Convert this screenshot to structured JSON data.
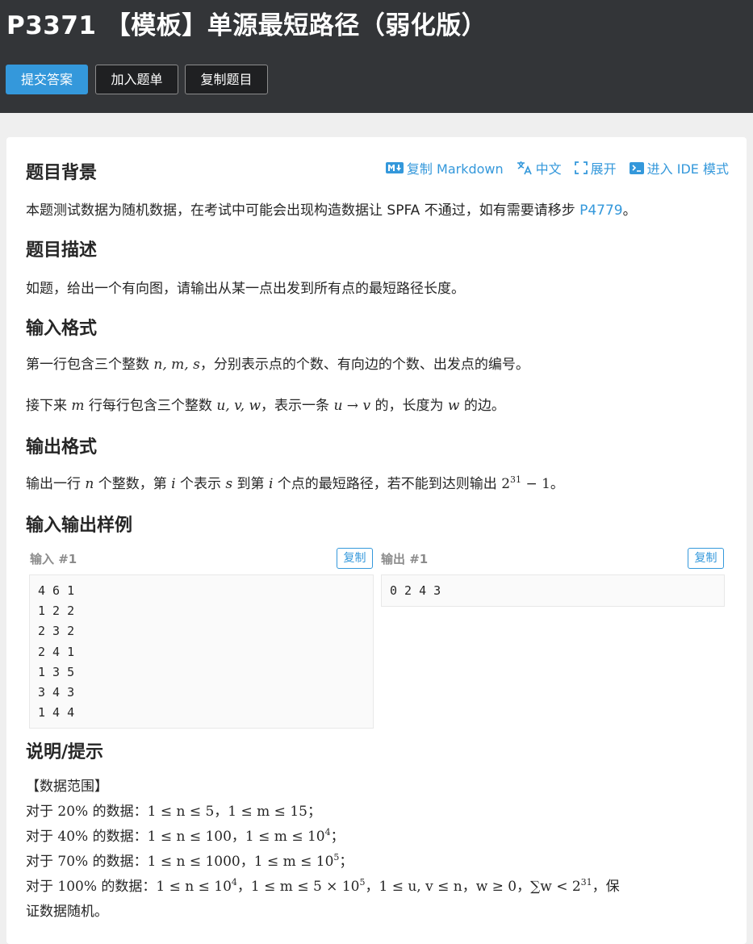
{
  "header": {
    "title": "P3371 【模板】单源最短路径（弱化版）",
    "buttons": {
      "submit": "提交答案",
      "add_to_list": "加入题单",
      "copy_problem": "复制题目"
    }
  },
  "toolbar": {
    "copy_markdown": "复制 Markdown",
    "language": "中文",
    "expand": "展开",
    "ide_mode": "进入 IDE 模式"
  },
  "sections": {
    "background": {
      "heading": "题目背景",
      "text_before": "本题测试数据为随机数据，在考试中可能会出现构造数据让 SPFA 不通过，如有需要请移步 ",
      "link": "P4779",
      "text_after": "。"
    },
    "description": {
      "heading": "题目描述",
      "text": "如题，给出一个有向图，请输出从某一点出发到所有点的最短路径长度。"
    },
    "input_format": {
      "heading": "输入格式",
      "line1_a": "第一行包含三个整数 ",
      "line1_math": "n, m, s",
      "line1_b": "，分别表示点的个数、有向边的个数、出发点的编号。",
      "line2_a": "接下来 ",
      "line2_m": "m",
      "line2_b": " 行每行包含三个整数 ",
      "line2_uvw": "u, v, w",
      "line2_c": "，表示一条 ",
      "line2_edge": "u → v",
      "line2_d": " 的，长度为 ",
      "line2_w": "w",
      "line2_e": " 的边。"
    },
    "output_format": {
      "heading": "输出格式",
      "a": "输出一行 ",
      "n": "n",
      "b": " 个整数，第 ",
      "i": "i",
      "c": " 个表示 ",
      "s": "s",
      "d": " 到第 ",
      "i2": "i",
      "e": " 个点的最短路径，若不能到达则输出 ",
      "pow_base": "2",
      "pow_exp": "31",
      "pow_tail": " − 1",
      "f": "。"
    },
    "samples": {
      "heading": "输入输出样例",
      "input_label": "输入 #1",
      "output_label": "输出 #1",
      "copy": "复制",
      "input_lines": [
        "4 6 1",
        "1 2 2",
        "2 3 2",
        "2 4 1",
        "1 3 5",
        "3 4 3",
        "1 4 4"
      ],
      "output_lines": [
        "0 2 4 3"
      ]
    },
    "hint": {
      "heading": "说明/提示",
      "range_title": "【数据范围】",
      "r1_a": "对于 ",
      "r1_pct": "20%",
      "r1_b": " 的数据：",
      "r1_math": "1 ≤ n ≤ 5，1 ≤ m ≤ 15；",
      "r2_a": "对于 ",
      "r2_pct": "40%",
      "r2_b": " 的数据：",
      "r2_math": "1 ≤ n ≤ 100，1 ≤ m ≤ 10",
      "r2_exp": "4",
      "r2_end": "；",
      "r3_a": "对于 ",
      "r3_pct": "70%",
      "r3_b": " 的数据：",
      "r3_math": "1 ≤ n ≤ 1000，1 ≤ m ≤ 10",
      "r3_exp": "5",
      "r3_end": "；",
      "r4_a": "对于 ",
      "r4_pct": "100%",
      "r4_b": " 的数据：",
      "r4_m1": "1 ≤ n ≤ 10",
      "r4_e1": "4",
      "r4_m2": "，1 ≤ m ≤ 5 × 10",
      "r4_e2": "5",
      "r4_m3": "，1 ≤ u, v ≤ n，w ≥ 0，∑w < 2",
      "r4_e3": "31",
      "r4_end": "，保",
      "r4_line2": "证数据随机。"
    }
  },
  "colors": {
    "header_bg": "#333538",
    "accent": "#3498db",
    "page_bg": "#efefef"
  }
}
